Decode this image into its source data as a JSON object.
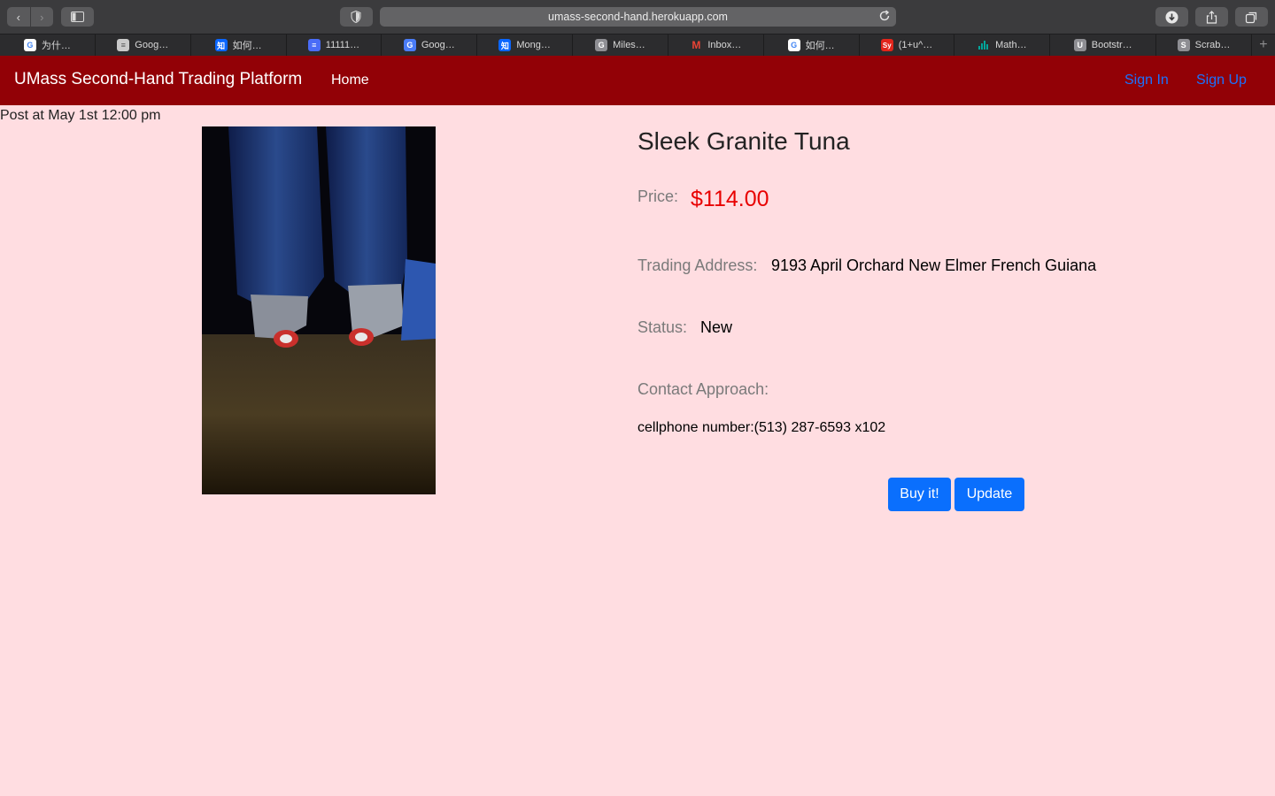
{
  "browser": {
    "url": "umass-second-hand.herokuapp.com",
    "tabs": [
      {
        "label": "为什…",
        "icon": "google-icon",
        "color": "#4285f4"
      },
      {
        "label": "Goog…",
        "icon": "google-docs-icon",
        "color": "#c9c9c9"
      },
      {
        "label": "如何…",
        "icon": "zhihu-icon",
        "color": "#0a66ff"
      },
      {
        "label": "11111…",
        "icon": "document-icon",
        "color": "#4a6cf7"
      },
      {
        "label": "Goog…",
        "icon": "google-translate-icon",
        "color": "#4a7cf6"
      },
      {
        "label": "Mong…",
        "icon": "zhihu-icon",
        "color": "#0a66ff"
      },
      {
        "label": "Miles…",
        "icon": "letter-g-icon",
        "color": "#8e8e93"
      },
      {
        "label": "Inbox…",
        "icon": "gmail-icon",
        "color": "#ea4335"
      },
      {
        "label": "如何…",
        "icon": "google-icon",
        "color": "#4285f4"
      },
      {
        "label": "(1+u^…",
        "icon": "symbolab-icon",
        "color": "#e1251b"
      },
      {
        "label": "Math…",
        "icon": "bar-chart-icon",
        "color": "#00a59b"
      },
      {
        "label": "Bootstr…",
        "icon": "letter-u-icon",
        "color": "#8e8e93"
      },
      {
        "label": "Scrab…",
        "icon": "letter-s-icon",
        "color": "#8e8e93"
      }
    ]
  },
  "navbar": {
    "brand": "UMass Second-Hand Trading Platform",
    "home": "Home",
    "sign_in": "Sign In",
    "sign_up": "Sign Up"
  },
  "post": {
    "posted_at": "Post at May 1st 12:00 pm",
    "title": "Sleek Granite Tuna",
    "price_label": "Price:",
    "price": "$114.00",
    "address_label": "Trading Address:",
    "address": "9193 April Orchard New Elmer French Guiana",
    "status_label": "Status:",
    "status": "New",
    "contact_label": "Contact Approach:",
    "contact": "cellphone number:(513) 287-6593 x102"
  },
  "actions": {
    "buy": "Buy it!",
    "update": "Update"
  }
}
